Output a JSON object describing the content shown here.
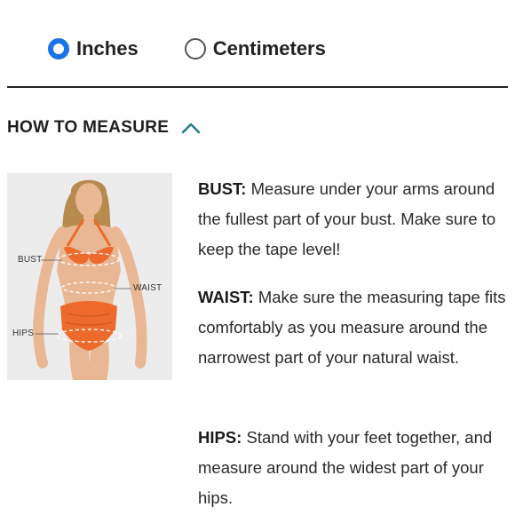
{
  "units": {
    "options": [
      {
        "label": "Inches",
        "selected": true
      },
      {
        "label": "Centimeters",
        "selected": false
      }
    ],
    "accent": "#1a73e8"
  },
  "section": {
    "title": "HOW TO MEASURE",
    "expanded": true,
    "chevron_icon": "chevron-up-icon",
    "chevron_color": "#1e7a86"
  },
  "figure": {
    "labels": {
      "bust": "BUST",
      "waist": "WAIST",
      "hips": "HIPS"
    },
    "swimsuit_color": "#ee6a2c",
    "background": "#ececec"
  },
  "instructions": [
    {
      "term": "BUST:",
      "text": "Measure under your arms around the fullest part of your bust. Make sure to keep the tape level!"
    },
    {
      "term": "WAIST:",
      "text": "Make sure the measuring tape fits comfortably as you measure around the narrowest part of your natural waist."
    },
    {
      "term": "HIPS:",
      "text": "Stand with your feet together, and measure around the widest part of your hips."
    }
  ]
}
